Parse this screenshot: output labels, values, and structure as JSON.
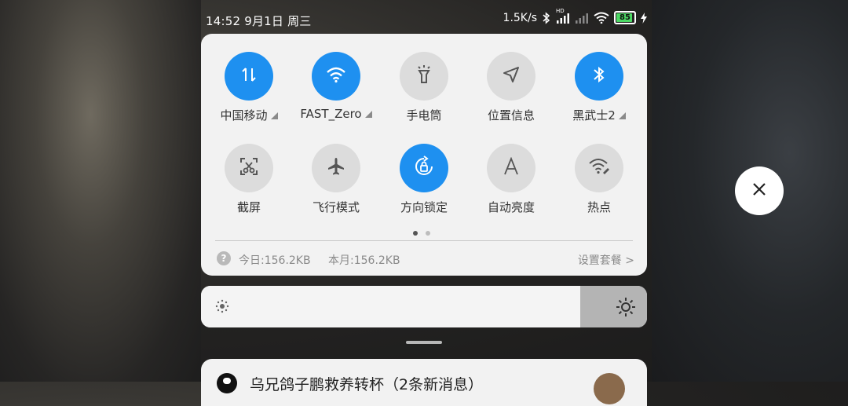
{
  "status_bar": {
    "time": "14:52",
    "date": "9月1日",
    "weekday": "周三",
    "net_speed": "1.5K/s",
    "network_type": "HD",
    "battery_level": "85",
    "icons": [
      "bluetooth-icon",
      "signal-icon",
      "signal-weak-icon",
      "wifi-icon",
      "battery-icon",
      "charging-icon"
    ]
  },
  "quick_settings": {
    "tiles": [
      {
        "label": "中国移动",
        "icon": "mobile-data-icon",
        "on": true,
        "has_menu": true
      },
      {
        "label": "FAST_Zero",
        "icon": "wifi-icon",
        "on": true,
        "has_menu": true
      },
      {
        "label": "手电筒",
        "icon": "flashlight-icon",
        "on": false,
        "has_menu": false
      },
      {
        "label": "位置信息",
        "icon": "location-icon",
        "on": false,
        "has_menu": false
      },
      {
        "label": "黑武士2",
        "icon": "bluetooth-icon",
        "on": true,
        "has_menu": true
      },
      {
        "label": "截屏",
        "icon": "screenshot-icon",
        "on": false,
        "has_menu": false
      },
      {
        "label": "飞行模式",
        "icon": "airplane-icon",
        "on": false,
        "has_menu": false
      },
      {
        "label": "方向锁定",
        "icon": "rotation-lock-icon",
        "on": true,
        "has_menu": false
      },
      {
        "label": "自动亮度",
        "icon": "auto-brightness-icon",
        "on": false,
        "has_menu": false
      },
      {
        "label": "热点",
        "icon": "hotspot-icon",
        "on": false,
        "has_menu": false
      }
    ],
    "page_count": 2,
    "active_page": 1
  },
  "data_usage": {
    "today": "今日:156.2KB",
    "month": "本月:156.2KB",
    "plan_link": "设置套餐 >",
    "help": "?"
  },
  "brightness": {
    "level_percent": 85
  },
  "notification": {
    "title": "乌兄鸽子鹏救养转杯（2条新消息）"
  },
  "colors": {
    "accent": "#1e90f0",
    "tile_off": "#dcdcdc",
    "panel": "#f2f2f2"
  }
}
